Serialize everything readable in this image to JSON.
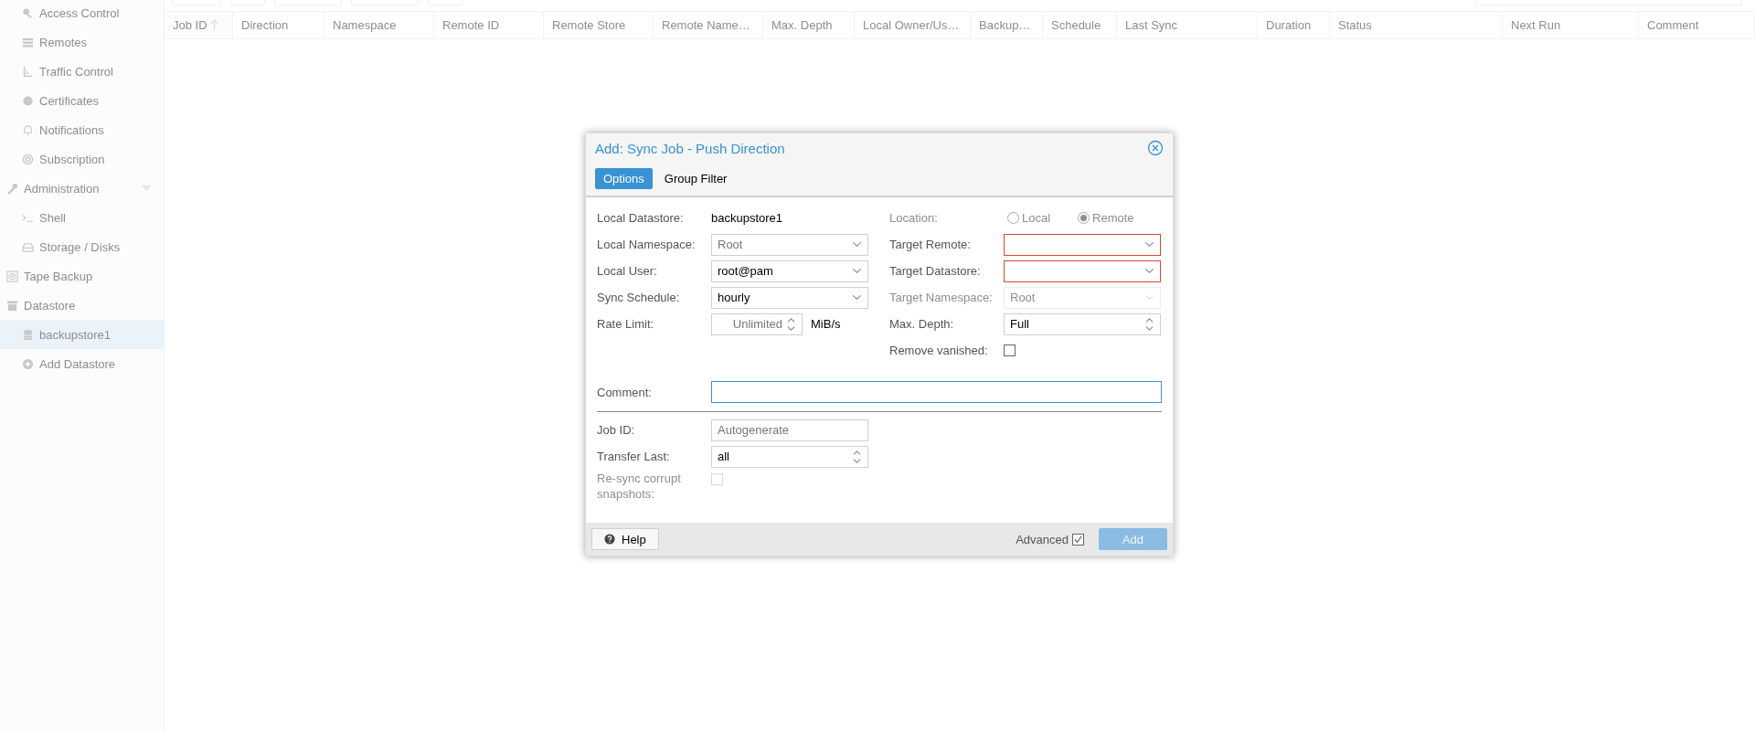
{
  "sidebar": {
    "continued_items": [
      {
        "label": "Access Control",
        "selected": false
      },
      {
        "label": "Remotes",
        "selected": false
      },
      {
        "label": "Traffic Control",
        "selected": false
      },
      {
        "label": "Certificates",
        "selected": false
      },
      {
        "label": "Notifications",
        "selected": false
      },
      {
        "label": "Subscription",
        "selected": false
      }
    ],
    "items": [
      {
        "label": "Administration",
        "selected": false,
        "expanded": true,
        "children": [
          {
            "label": "Shell",
            "selected": false
          },
          {
            "label": "Storage / Disks",
            "selected": false
          }
        ]
      },
      {
        "label": "Tape Backup",
        "selected": false
      },
      {
        "label": "Datastore",
        "selected": false,
        "expanded": true,
        "children": [
          {
            "label": "backupstore1",
            "selected": true
          },
          {
            "label": "Add Datastore",
            "selected": false
          }
        ]
      }
    ]
  },
  "table": {
    "columns": [
      {
        "label": "Job ID",
        "sorted": true
      },
      {
        "label": "Direction",
        "sorted": false
      },
      {
        "label": "Namespace",
        "sorted": false
      },
      {
        "label": "Remote ID",
        "sorted": false
      },
      {
        "label": "Remote Store",
        "sorted": false
      },
      {
        "label": "Remote Name…",
        "sorted": false
      },
      {
        "label": "Max. Depth",
        "sorted": false
      },
      {
        "label": "Local Owner/Us…",
        "sorted": false
      },
      {
        "label": "Backup…",
        "sorted": false
      },
      {
        "label": "Schedule",
        "sorted": false
      },
      {
        "label": "Last Sync",
        "sorted": false
      },
      {
        "label": "Duration",
        "sorted": false
      },
      {
        "label": "Status",
        "sorted": false
      },
      {
        "label": "Next Run",
        "sorted": false
      },
      {
        "label": "Comment",
        "sorted": false
      }
    ]
  },
  "dialog": {
    "title": "Add: Sync Job - Push Direction",
    "tabs": [
      {
        "label": "Options",
        "selected": true
      },
      {
        "label": "Group Filter",
        "selected": false
      }
    ],
    "left_fields": [
      {
        "kind": "display",
        "label": "Local Datastore:",
        "value": "backupstore1",
        "disabled": false
      },
      {
        "kind": "combo",
        "label": "Local Namespace:",
        "placeholder": "Root",
        "disabled": false
      },
      {
        "kind": "combo",
        "label": "Local User:",
        "value": "root@pam",
        "disabled": false
      },
      {
        "kind": "combo",
        "label": "Sync Schedule:",
        "value": "hourly",
        "disabled": false
      },
      {
        "kind": "spinner",
        "label": "Rate Limit:",
        "placeholder": "Unlimited",
        "unit": "MiB/s",
        "disabled": false
      }
    ],
    "right_fields": [
      {
        "kind": "radio",
        "label": "Location:",
        "disabled": true,
        "options": [
          {
            "label": "Local",
            "selected": false
          },
          {
            "label": "Remote",
            "selected": true
          }
        ]
      },
      {
        "kind": "combo",
        "label": "Target Remote:",
        "disabled": false,
        "invalid": true
      },
      {
        "kind": "combo",
        "label": "Target Datastore:",
        "disabled": false,
        "invalid": true
      },
      {
        "kind": "combo",
        "label": "Target Namespace:",
        "placeholder": "Root",
        "disabled": true
      },
      {
        "kind": "spinner",
        "label": "Max. Depth:",
        "value": "Full",
        "disabled": false
      },
      {
        "kind": "checkbox",
        "label": "Remove vanished:",
        "checked": false,
        "disabled": false
      }
    ],
    "comment": {
      "label": "Comment:",
      "focused": true
    },
    "advanced_fields": [
      {
        "kind": "text",
        "label": "Job ID:",
        "placeholder": "Autogenerate",
        "disabled": false
      },
      {
        "kind": "spinner",
        "label": "Transfer Last:",
        "value": "all",
        "disabled": false
      },
      {
        "kind": "checkbox",
        "label": "Re-sync corrupt snapshots:",
        "checked": false,
        "disabled": true
      }
    ],
    "footer": {
      "help_button": "Help",
      "advanced": {
        "label": "Advanced",
        "checked": true
      },
      "add_button": {
        "label": "Add",
        "disabled": true
      }
    }
  }
}
